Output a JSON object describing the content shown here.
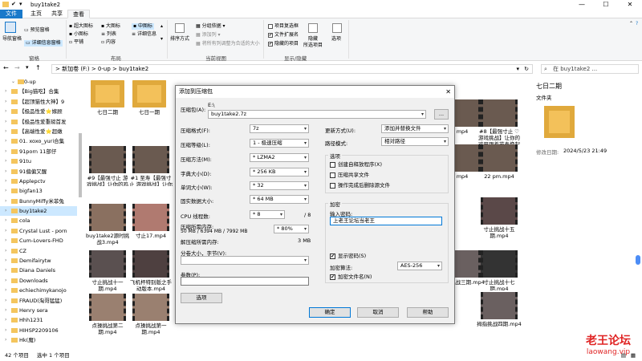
{
  "window": {
    "title": "buy1take2",
    "min": "—",
    "max": "☐",
    "close": "✕"
  },
  "tabs": {
    "file": "文件",
    "home": "主页",
    "share": "共享",
    "view": "查看"
  },
  "ribbon": {
    "nav_pane": "导航窗格",
    "preview_pane": "预览窗格",
    "details_pane": "详细信息窗格",
    "pane_group": "窗格",
    "xl_icons": "超大图标",
    "l_icons": "大图标",
    "m_icons": "中图标",
    "s_icons": "小图标",
    "list": "列表",
    "details": "详细信息",
    "tiles": "平铺",
    "content": "内容",
    "layout_group": "布局",
    "sort_by": "排序方式",
    "group_by": "分组依据",
    "add_cols": "添加列",
    "fit_cols": "将所有列调整为合适的大小",
    "current_view_group": "当前视图",
    "item_checkboxes": "项目复选框",
    "file_ext": "文件扩展名",
    "hidden_items": "隐藏的项目",
    "hide_selected": "隐藏\n所选项目",
    "options": "选项",
    "show_hide_group": "显示/隐藏"
  },
  "address": {
    "path": "> 新加卷 (F:) > 0-up > buy1take2",
    "search_placeholder": "在 buy1take2 ..."
  },
  "nav": {
    "items": [
      {
        "label": "0-up",
        "top": true
      },
      {
        "label": "【Big猫吃】合集"
      },
      {
        "label": "【超顶猫性大神】9"
      },
      {
        "label": "【极品性爱⭐嫁顾"
      },
      {
        "label": "【极品性爱重磅首发"
      },
      {
        "label": "【高端性爱⭐超嫩"
      },
      {
        "label": "01. xoxo_yuri合集"
      },
      {
        "label": "91porn 11部仔"
      },
      {
        "label": "91tu"
      },
      {
        "label": "91偏偏又醒"
      },
      {
        "label": "Applepctv"
      },
      {
        "label": "bigfan13"
      },
      {
        "label": "BunnyMiffy米菲兔"
      },
      {
        "label": "buy1take2",
        "selected": true
      },
      {
        "label": "cola"
      },
      {
        "label": "Crystal Lust - porn"
      },
      {
        "label": "Cum-Lovers-FHD"
      },
      {
        "label": "CZ"
      },
      {
        "label": "Demifairytw"
      },
      {
        "label": "Diana Daniels"
      },
      {
        "label": "Downloads"
      },
      {
        "label": "echiechimykanojo"
      },
      {
        "label": "FRAUD(淘哥猛猛)"
      },
      {
        "label": "Henry sera"
      },
      {
        "label": "Hhh1231"
      },
      {
        "label": "HIHSP2209106"
      },
      {
        "label": "Hk(魔)"
      }
    ]
  },
  "files": [
    {
      "label": "七日二期",
      "kind": "folder"
    },
    {
      "label": "七日一期",
      "kind": "folder"
    },
    {
      "label": "#9【最强寸止 游戏挑战】让你的鸡巴跟着节奏撸起来，",
      "kind": "video"
    },
    {
      "label": "#1 至寿【最强寸止 游戏挑战】让你的鸡巴跟着节奏撸起来，",
      "kind": "video"
    },
    {
      "label": "buy1take2源时挑战3.mp4",
      "kind": "video"
    },
    {
      "label": "寸止17.mp4",
      "kind": "video"
    },
    {
      "label": "寸止挑战十一期.mp4",
      "kind": "video"
    },
    {
      "label": "飞机杯特别版之手动版本.mp4",
      "kind": "video"
    },
    {
      "label": "点操挑战第二期.mp4",
      "kind": "video"
    },
    {
      "label": "点操挑战第一期.mp4",
      "kind": "video"
    }
  ],
  "files_right": [
    {
      "label": "#8【最强寸止 ♡游戏挑战】让你的鸡巴跟着节奏撸起来，"
    },
    {
      "label": "22 pm.mp4"
    },
    {
      "label": "寸止挑战十五期.mp4"
    },
    {
      "label": "寸止挑战十七期.mp4"
    },
    {
      "label": "拇指挑战四期.mp4"
    }
  ],
  "files_mid": [
    {
      "label": "mp4"
    },
    {
      "label": "mp4"
    },
    {
      "label": "寸止挑战三期.mp4"
    }
  ],
  "preview": {
    "title": "七日二期",
    "type": "文件夹",
    "modified_label": "修改日期:",
    "modified_value": "2024/5/23 21:49"
  },
  "status": {
    "count": "42 个项目",
    "selected": "选中 1 个项目"
  },
  "watermark": {
    "main": "老王论坛",
    "sub": "laowang.vip"
  },
  "dialog": {
    "title": "添加到压缩包",
    "close": "✕",
    "archive_label": "压缩包(A):",
    "archive_dir": "E:\\",
    "archive_name": "buy1take2.7z",
    "browse": "...",
    "format_label": "压缩格式(F):",
    "format_value": "7z",
    "level_label": "压缩等级(L):",
    "level_value": "1 - 极速压缩",
    "method_label": "压缩方法(M):",
    "method_value": "* LZMA2",
    "dict_label": "字典大小(D):",
    "dict_value": "* 256 KB",
    "word_label": "单词大小(W):",
    "word_value": "* 32",
    "solid_label": "固实数据大小:",
    "solid_value": "* 64 MB",
    "cpu_label": "CPU 线程数:",
    "cpu_value": "* 8",
    "cpu_total": "/ 8",
    "mem_label": "压缩所需内存:",
    "mem_value": "50 MB / 6394 MB / 7992 MB",
    "mem_pct": "* 80%",
    "decomp_label": "解压缩所需内存:",
    "decomp_value": "3 MB",
    "split_label": "分卷大小，字节(V):",
    "split_value": "",
    "params_label": "参数(P):",
    "params_value": "",
    "options_btn": "选项",
    "update_label": "更新方式(U):",
    "update_value": "添加并替换文件",
    "pathmode_label": "路径模式:",
    "pathmode_value": "相对路径",
    "opts_group": "选项",
    "sfx": "创建自释放程序(X)",
    "shared": "压缩共享文件",
    "delete_after": "操作完成后删除源文件",
    "enc_group": "加密",
    "pwd_label": "输入密码:",
    "pwd_value": "上老王论坛当老王",
    "show_pwd": "显示密码(S)",
    "enc_method_label": "加密算法:",
    "enc_method_value": "AES-256",
    "enc_names": "加密文件名(N)",
    "ok": "确定",
    "cancel": "取消",
    "help": "帮助"
  }
}
